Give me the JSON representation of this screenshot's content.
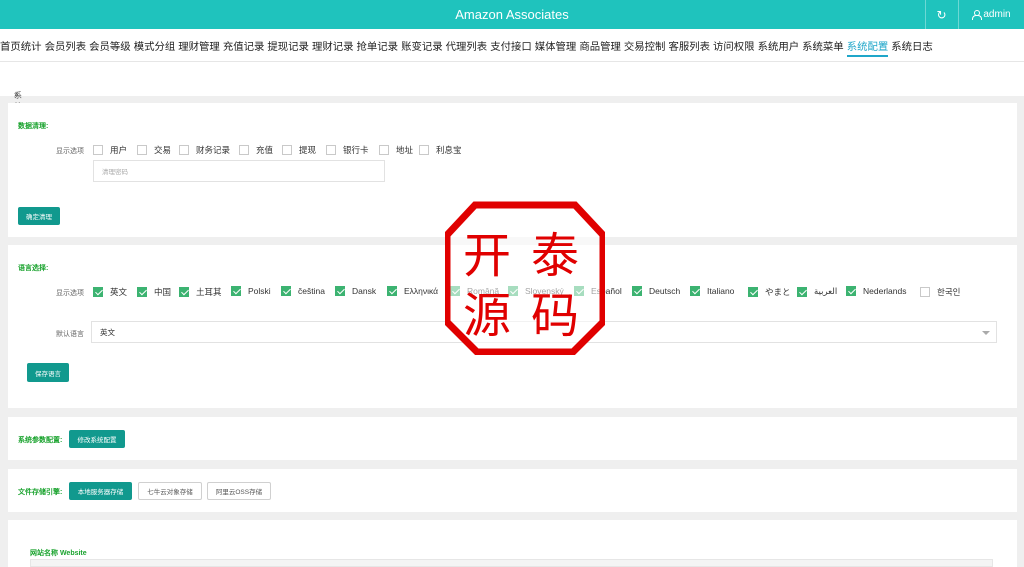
{
  "header": {
    "title": "Amazon Associates",
    "refresh_icon": "refresh-icon",
    "user_icon": "user-icon",
    "username": "admin"
  },
  "nav": {
    "items": [
      "首页统计",
      "会员列表",
      "会员等级",
      "模式分组",
      "理财管理",
      "充值记录",
      "提现记录",
      "理财记录",
      "抢单记录",
      "账变记录",
      "代理列表",
      "支付接口",
      "媒体管理",
      "商品管理",
      "交易控制",
      "客服列表",
      "访问权限",
      "系统用户",
      "系统菜单",
      "系统配置",
      "系统日志"
    ],
    "active": "系统配置"
  },
  "breadcrumb": {
    "arrow": "»",
    "text": "系统参数配置"
  },
  "data_cleanup": {
    "title": "数据清理:",
    "options_label": "显示选项",
    "options": [
      "用户",
      "交易",
      "财务记录",
      "充值",
      "提现",
      "银行卡",
      "地址",
      "利息宝"
    ],
    "password_placeholder": "清理密码",
    "confirm_button": "确定清理"
  },
  "language": {
    "title": "语言选择:",
    "options_label": "显示选项",
    "options": [
      "英文",
      "中国",
      "土耳其",
      "Polski",
      "čeština",
      "Dansk",
      "Ελληνικά",
      "Română",
      "Slovenský",
      "Español",
      "Deutsch",
      "Italiano",
      "やまと",
      "العربية",
      "Nederlands",
      "한국인"
    ],
    "checked": [
      true,
      true,
      true,
      true,
      true,
      true,
      true,
      true,
      true,
      true,
      true,
      true,
      true,
      true,
      true,
      false
    ],
    "default_label": "默认语言",
    "default_value": "英文",
    "save_button": "保存语言"
  },
  "system_config": {
    "title": "系统参数配置:",
    "edit_button": "修改系统配置"
  },
  "storage": {
    "title": "文件存储引擎:",
    "buttons": [
      "本地服务器存储",
      "七牛云对象存储",
      "阿里云OSS存储"
    ],
    "active": "本地服务器存储"
  },
  "website": {
    "label": "网站名称 Website"
  },
  "stamp": {
    "chars": [
      "开",
      "泰",
      "源",
      "码"
    ],
    "color": "#e00000"
  }
}
